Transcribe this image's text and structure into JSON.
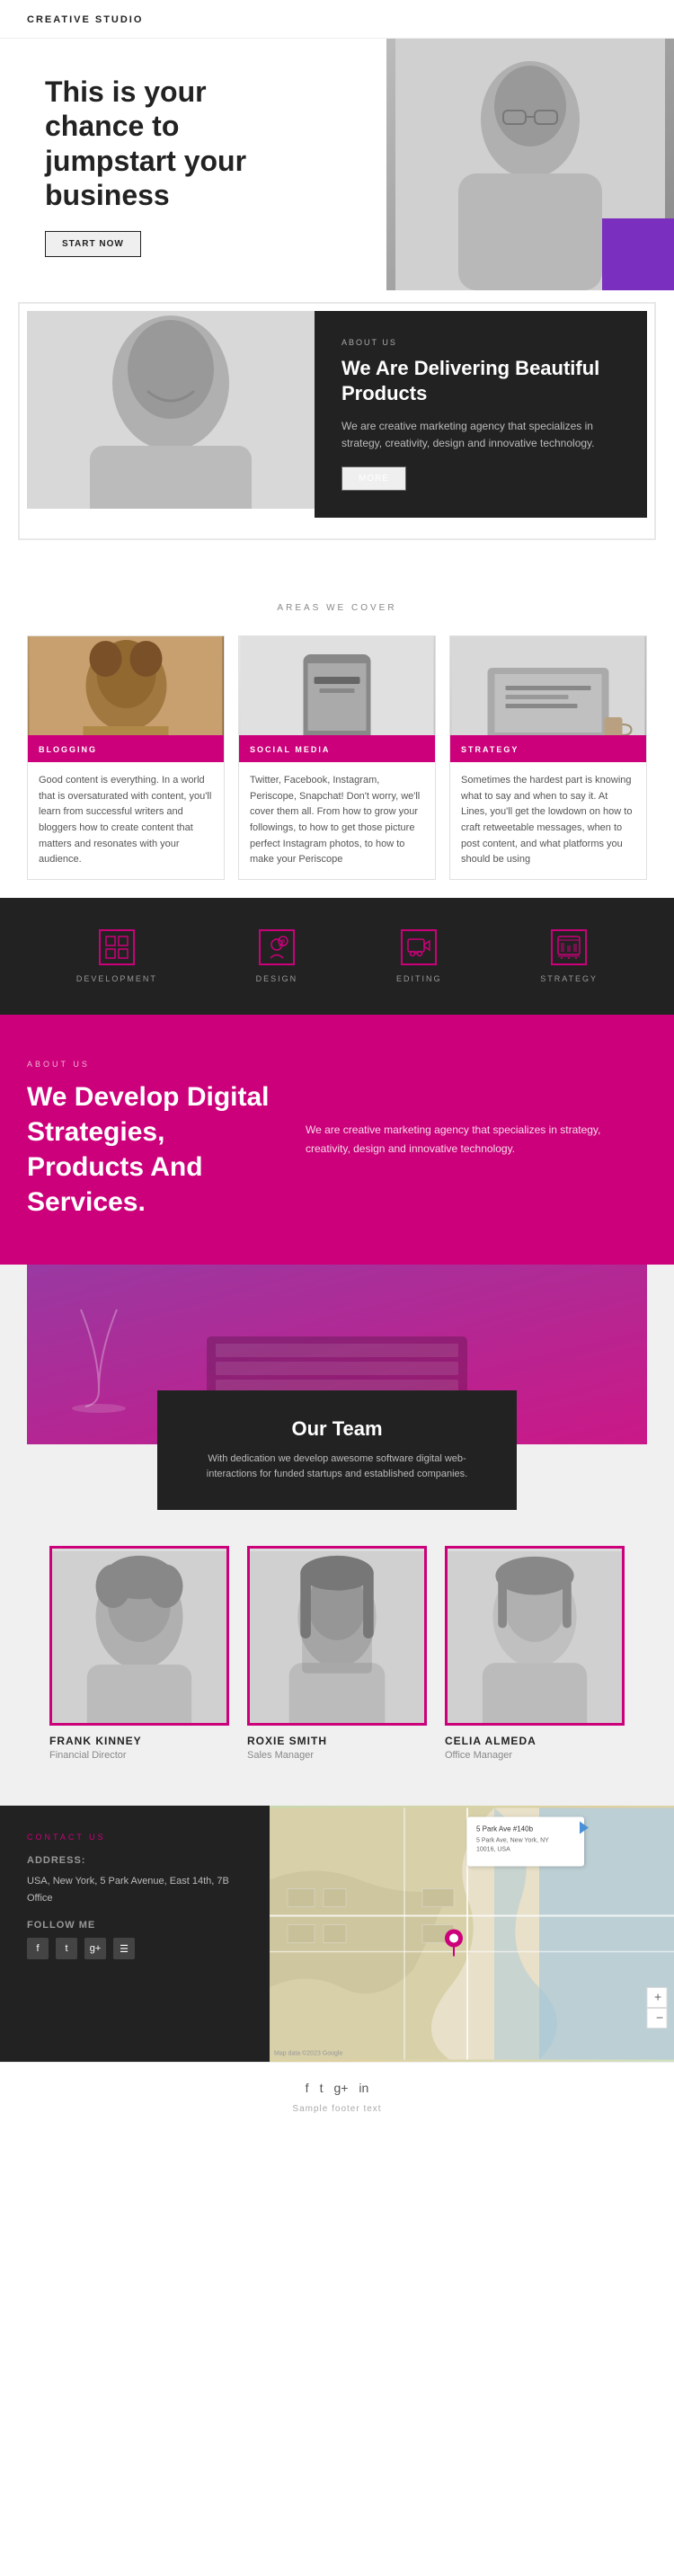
{
  "header": {
    "logo": "CREATIVE STUDIO"
  },
  "hero": {
    "heading_line1": "This is your",
    "heading_line2": "chance to",
    "heading_line3": "jumpstart your",
    "heading_line4": "business",
    "heading_full": "This is your chance to jumpstart your business",
    "cta_label": "START NOW"
  },
  "about": {
    "label": "ABOUT US",
    "heading": "We Are Delivering Beautiful Products",
    "description": "We are creative marketing agency that specializes in strategy, creativity, design and innovative technology.",
    "more_label": "MORE"
  },
  "areas": {
    "section_label": "AREAS WE COVER",
    "cards": [
      {
        "label": "BLOGGING",
        "description": "Good content is everything. In a world that is oversaturated with content, you'll learn from successful writers and bloggers how to create content that matters and resonates with your audience."
      },
      {
        "label": "SOCIAL MEDIA",
        "description": "Twitter, Facebook, Instagram, Periscope, Snapchat! Don't worry, we'll cover them all. From how to grow your followings, to how to get those picture perfect Instagram photos, to how to make your Periscope"
      },
      {
        "label": "STRATEGY",
        "description": "Sometimes the hardest part is knowing what to say and when to say it. At Lines, you'll get the lowdown on how to craft retweetable messages, when to post content, and what platforms you should be using"
      }
    ]
  },
  "dark_strip": {
    "items": [
      {
        "label": "DEVELOPMENT",
        "icon": "grid"
      },
      {
        "label": "DESIGN",
        "icon": "head"
      },
      {
        "label": "EDITING",
        "icon": "video"
      },
      {
        "label": "STRATEGY",
        "icon": "chart"
      }
    ]
  },
  "pink_about": {
    "label": "ABOUT US",
    "heading": "We Develop Digital Strategies, Products And Services.",
    "description": "We are creative marketing agency that specializes in strategy, creativity, design and innovative technology."
  },
  "team": {
    "heading": "Our Team",
    "description": "With dedication we develop awesome software digital web-interactions for funded startups and established companies.",
    "members": [
      {
        "name": "FRANK KINNEY",
        "role": "Financial Director"
      },
      {
        "name": "ROXIE SMITH",
        "role": "Sales Manager"
      },
      {
        "name": "CELIA ALMEDA",
        "role": "Office Manager"
      }
    ]
  },
  "contact": {
    "label": "CONTACT US",
    "address_label": "Address:",
    "address": "USA, New York, 5 Park Avenue, East 14th, 7B Office",
    "follow_label": "Follow me",
    "social_icons": [
      "f",
      "t",
      "g+",
      "in"
    ],
    "map_label": "5 Park Ave #140b\n5 Park Ave, New York, NY\n10016, USA"
  },
  "footer": {
    "social_icons": [
      "f",
      "t",
      "g+",
      "in"
    ],
    "text": "Sample footer text"
  }
}
